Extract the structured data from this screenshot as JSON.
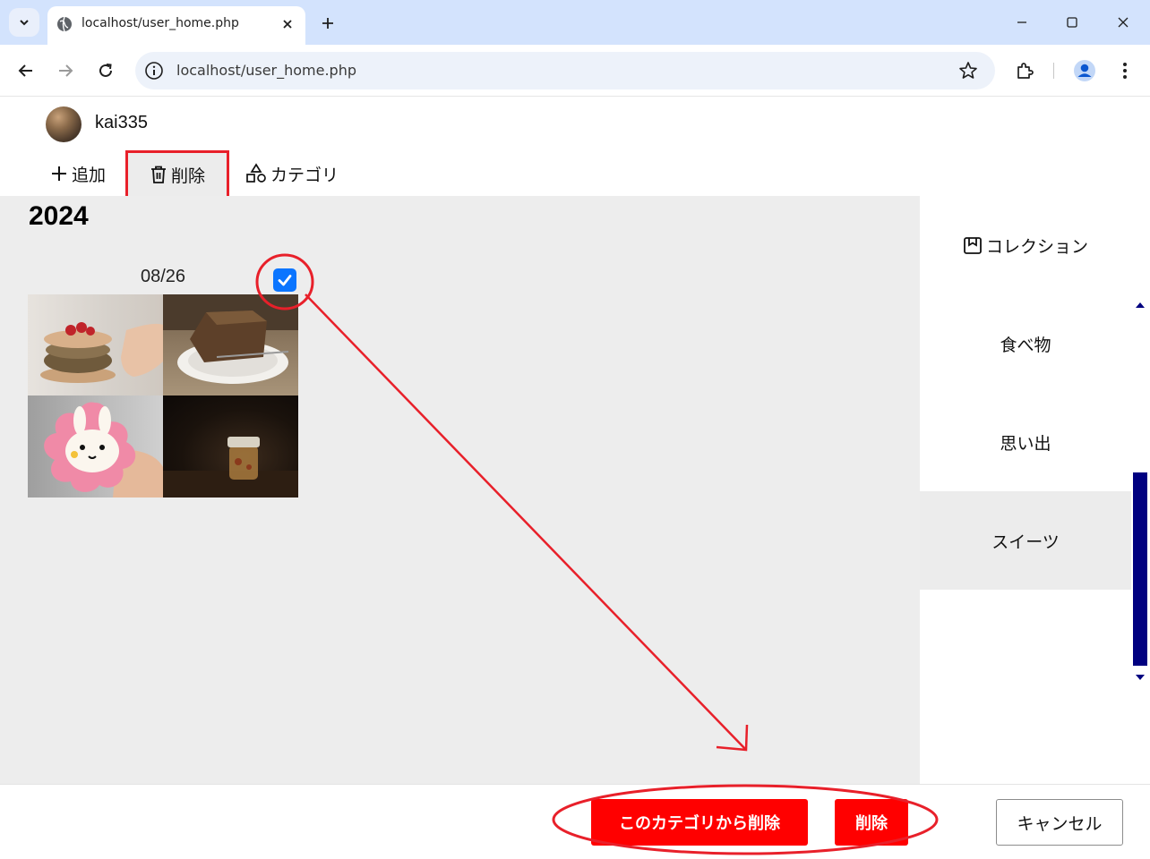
{
  "browser": {
    "tab_title": "localhost/user_home.php",
    "url": "localhost/user_home.php"
  },
  "user": {
    "name": "kai335"
  },
  "actions": {
    "add_label": "追加",
    "delete_label": "削除",
    "category_label": "カテゴリ"
  },
  "timeline": {
    "year": "2024",
    "groups": [
      {
        "date": "08/26",
        "selected": true,
        "photo_count": 4
      }
    ]
  },
  "sidebar": {
    "items": [
      {
        "label": "コレクション",
        "icon": "collection-icon",
        "active": false
      },
      {
        "label": "食べ物",
        "active": false
      },
      {
        "label": "思い出",
        "active": false
      },
      {
        "label": "スイーツ",
        "active": true
      }
    ]
  },
  "footer": {
    "remove_from_category_label": "このカテゴリから削除",
    "delete_label": "削除",
    "cancel_label": "キャンセル"
  },
  "colors": {
    "accent_red": "#ff0000",
    "checkbox_blue": "#0b75ff",
    "annotation_red": "#e8202a",
    "scroll_thumb": "#000080"
  }
}
